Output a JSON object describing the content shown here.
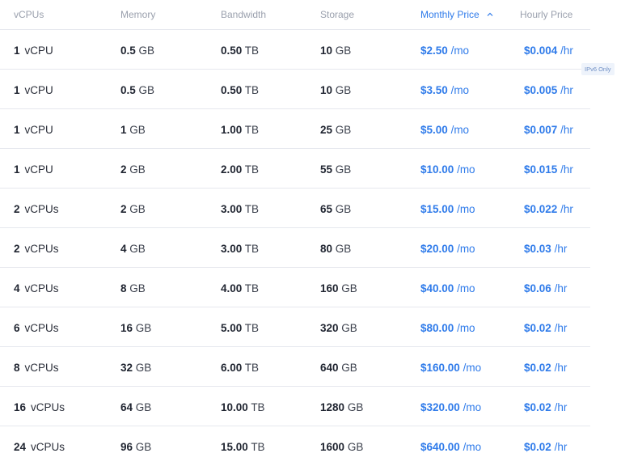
{
  "table": {
    "headers": {
      "vcpus": "vCPUs",
      "memory": "Memory",
      "bandwidth": "Bandwidth",
      "storage": "Storage",
      "monthly": "Monthly Price",
      "hourly": "Hourly Price"
    },
    "sort_icon": "chevron-up-icon",
    "badge": "IPv6 Only",
    "accent_color": "#2f7bea",
    "rows": [
      {
        "cpu": "1",
        "cpu_unit": "vCPU",
        "mem": "0.5",
        "mem_unit": "GB",
        "bw": "0.50",
        "bw_unit": "TB",
        "sto": "10",
        "sto_unit": "GB",
        "mon": "$2.50",
        "mon_unit": "/mo",
        "hr": "$0.004",
        "hr_unit": "/hr"
      },
      {
        "cpu": "1",
        "cpu_unit": "vCPU",
        "mem": "0.5",
        "mem_unit": "GB",
        "bw": "0.50",
        "bw_unit": "TB",
        "sto": "10",
        "sto_unit": "GB",
        "mon": "$3.50",
        "mon_unit": "/mo",
        "hr": "$0.005",
        "hr_unit": "/hr"
      },
      {
        "cpu": "1",
        "cpu_unit": "vCPU",
        "mem": "1",
        "mem_unit": "GB",
        "bw": "1.00",
        "bw_unit": "TB",
        "sto": "25",
        "sto_unit": "GB",
        "mon": "$5.00",
        "mon_unit": "/mo",
        "hr": "$0.007",
        "hr_unit": "/hr"
      },
      {
        "cpu": "1",
        "cpu_unit": "vCPU",
        "mem": "2",
        "mem_unit": "GB",
        "bw": "2.00",
        "bw_unit": "TB",
        "sto": "55",
        "sto_unit": "GB",
        "mon": "$10.00",
        "mon_unit": "/mo",
        "hr": "$0.015",
        "hr_unit": "/hr"
      },
      {
        "cpu": "2",
        "cpu_unit": "vCPUs",
        "mem": "2",
        "mem_unit": "GB",
        "bw": "3.00",
        "bw_unit": "TB",
        "sto": "65",
        "sto_unit": "GB",
        "mon": "$15.00",
        "mon_unit": "/mo",
        "hr": "$0.022",
        "hr_unit": "/hr"
      },
      {
        "cpu": "2",
        "cpu_unit": "vCPUs",
        "mem": "4",
        "mem_unit": "GB",
        "bw": "3.00",
        "bw_unit": "TB",
        "sto": "80",
        "sto_unit": "GB",
        "mon": "$20.00",
        "mon_unit": "/mo",
        "hr": "$0.03",
        "hr_unit": "/hr"
      },
      {
        "cpu": "4",
        "cpu_unit": "vCPUs",
        "mem": "8",
        "mem_unit": "GB",
        "bw": "4.00",
        "bw_unit": "TB",
        "sto": "160",
        "sto_unit": "GB",
        "mon": "$40.00",
        "mon_unit": "/mo",
        "hr": "$0.06",
        "hr_unit": "/hr"
      },
      {
        "cpu": "6",
        "cpu_unit": "vCPUs",
        "mem": "16",
        "mem_unit": "GB",
        "bw": "5.00",
        "bw_unit": "TB",
        "sto": "320",
        "sto_unit": "GB",
        "mon": "$80.00",
        "mon_unit": "/mo",
        "hr": "$0.02",
        "hr_unit": "/hr"
      },
      {
        "cpu": "8",
        "cpu_unit": "vCPUs",
        "mem": "32",
        "mem_unit": "GB",
        "bw": "6.00",
        "bw_unit": "TB",
        "sto": "640",
        "sto_unit": "GB",
        "mon": "$160.00",
        "mon_unit": "/mo",
        "hr": "$0.02",
        "hr_unit": "/hr"
      },
      {
        "cpu": "16",
        "cpu_unit": "vCPUs",
        "mem": "64",
        "mem_unit": "GB",
        "bw": "10.00",
        "bw_unit": "TB",
        "sto": "1280",
        "sto_unit": "GB",
        "mon": "$320.00",
        "mon_unit": "/mo",
        "hr": "$0.02",
        "hr_unit": "/hr"
      },
      {
        "cpu": "24",
        "cpu_unit": "vCPUs",
        "mem": "96",
        "mem_unit": "GB",
        "bw": "15.00",
        "bw_unit": "TB",
        "sto": "1600",
        "sto_unit": "GB",
        "mon": "$640.00",
        "mon_unit": "/mo",
        "hr": "$0.02",
        "hr_unit": "/hr"
      }
    ]
  }
}
